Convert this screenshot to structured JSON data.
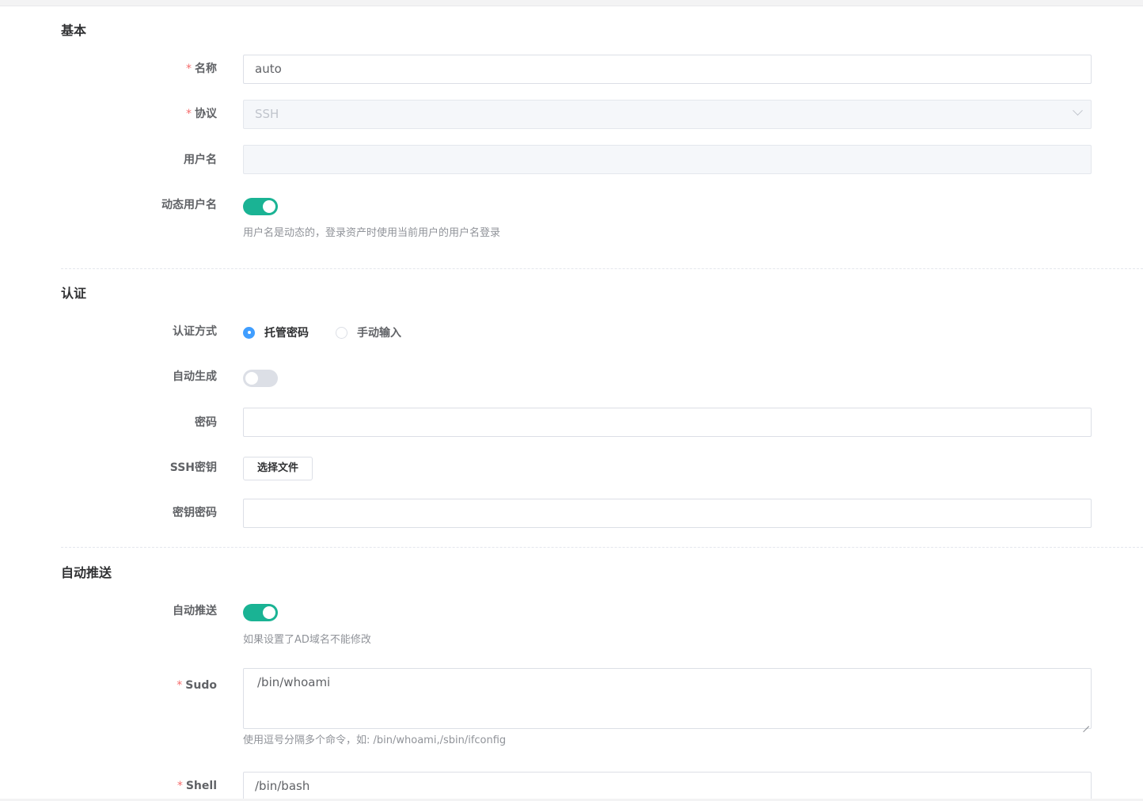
{
  "sections": {
    "basic": {
      "title": "基本"
    },
    "auth": {
      "title": "认证"
    },
    "push": {
      "title": "自动推送"
    }
  },
  "fields": {
    "name": {
      "label": "名称",
      "value": "auto",
      "required": true
    },
    "protocol": {
      "label": "协议",
      "value": "SSH",
      "required": true
    },
    "username": {
      "label": "用户名",
      "value": ""
    },
    "dynamic_username": {
      "label": "动态用户名",
      "on": true,
      "hint": "用户名是动态的，登录资产时使用当前用户的用户名登录"
    },
    "auth_method": {
      "label": "认证方式",
      "options": [
        {
          "label": "托管密码",
          "checked": true
        },
        {
          "label": "手动输入",
          "checked": false
        }
      ]
    },
    "auto_generate": {
      "label": "自动生成",
      "on": false
    },
    "password": {
      "label": "密码",
      "value": ""
    },
    "ssh_key": {
      "label": "SSH密钥",
      "button": "选择文件"
    },
    "key_password": {
      "label": "密钥密码",
      "value": ""
    },
    "auto_push": {
      "label": "自动推送",
      "on": true,
      "hint": "如果设置了AD域名不能修改"
    },
    "sudo": {
      "label": "Sudo",
      "value": "/bin/whoami",
      "required": true,
      "hint": "使用逗号分隔多个命令，如: /bin/whoami,/sbin/ifconfig"
    },
    "shell": {
      "label": "Shell",
      "value": "/bin/bash",
      "required": true
    }
  },
  "colors": {
    "switch_on": "#1ab394",
    "radio_checked": "#409eff",
    "required_star": "#f56c6c"
  }
}
